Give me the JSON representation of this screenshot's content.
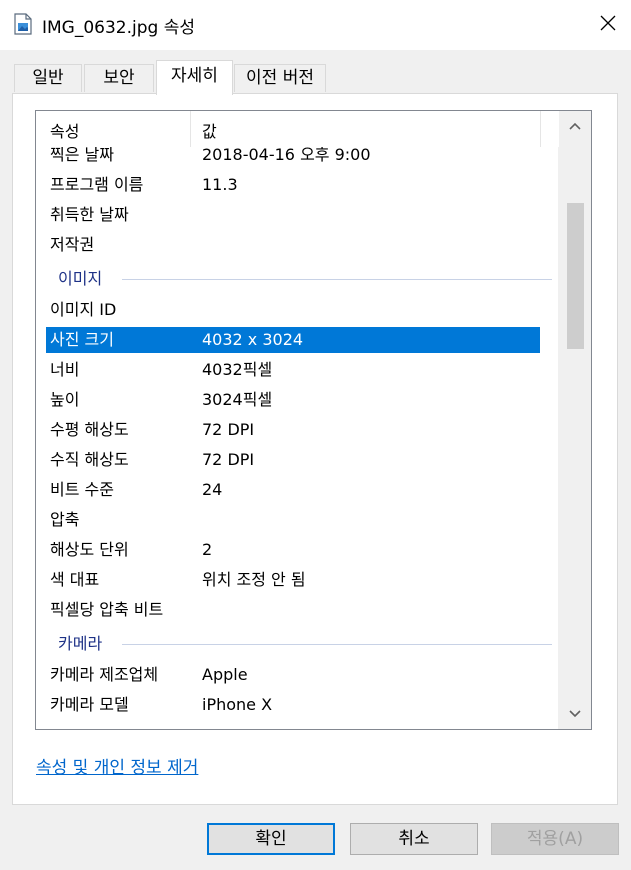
{
  "window": {
    "title": "IMG_0632.jpg 속성"
  },
  "tabs": [
    "일반",
    "보안",
    "자세히",
    "이전 버전"
  ],
  "active_tab": "자세히",
  "columns": {
    "name": "속성",
    "value": "값"
  },
  "rows": [
    {
      "name": "찍은 날짜",
      "value": "2018-04-16 오후 9:00"
    },
    {
      "name": "프로그램 이름",
      "value": "11.3"
    },
    {
      "name": "취득한 날짜",
      "value": ""
    },
    {
      "name": "저작권",
      "value": ""
    },
    {
      "group": "이미지"
    },
    {
      "name": "이미지 ID",
      "value": ""
    },
    {
      "name": "사진 크기",
      "value": "4032 x 3024",
      "selected": true
    },
    {
      "name": "너비",
      "value": "4032픽셀"
    },
    {
      "name": "높이",
      "value": "3024픽셀"
    },
    {
      "name": "수평 해상도",
      "value": "72 DPI"
    },
    {
      "name": "수직 해상도",
      "value": "72 DPI"
    },
    {
      "name": "비트 수준",
      "value": "24"
    },
    {
      "name": "압축",
      "value": ""
    },
    {
      "name": "해상도 단위",
      "value": "2"
    },
    {
      "name": "색 대표",
      "value": "위치 조정 안 됨"
    },
    {
      "name": "픽셀당 압축 비트",
      "value": ""
    },
    {
      "group": "카메라"
    },
    {
      "name": "카메라 제조업체",
      "value": "Apple"
    },
    {
      "name": "카메라 모델",
      "value": "iPhone X"
    }
  ],
  "scroll_position": 0.27,
  "remove_link": "속성 및 개인 정보 제거",
  "buttons": {
    "ok": "확인",
    "cancel": "취소",
    "apply": "적용(A)"
  },
  "colors": {
    "selection": "#0078d7",
    "group_text": "#1e3287",
    "link": "#0066cc"
  }
}
